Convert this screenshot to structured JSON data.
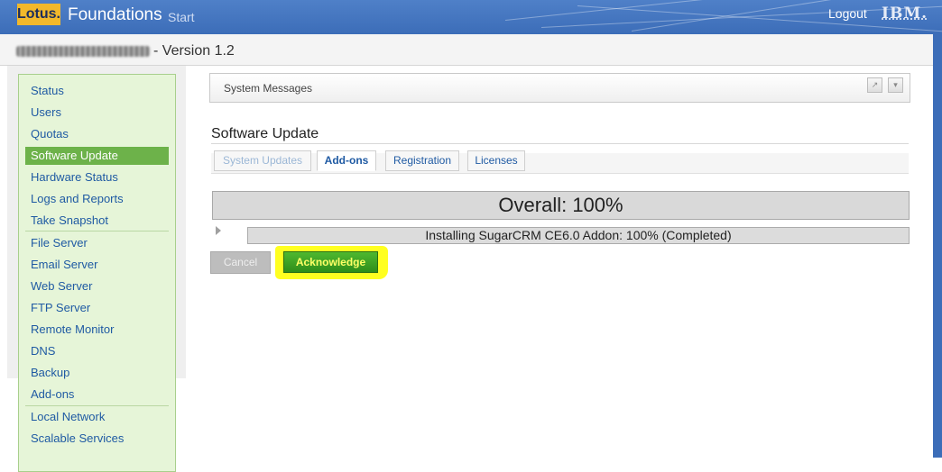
{
  "header": {
    "brand_logo": "Lotus.",
    "product": "Foundations",
    "product_sub": "Start",
    "logout": "Logout",
    "vendor_logo": "IBM."
  },
  "host": {
    "version": "- Version 1.2"
  },
  "nav": {
    "items": [
      {
        "label": "Status",
        "active": false
      },
      {
        "label": "Users",
        "active": false
      },
      {
        "label": "Quotas",
        "active": false
      },
      {
        "label": "Software Update",
        "active": true
      },
      {
        "label": "Hardware Status",
        "active": false
      },
      {
        "label": "Logs and Reports",
        "active": false
      },
      {
        "label": "Take Snapshot",
        "active": false
      },
      {
        "label": "File Server",
        "active": false
      },
      {
        "label": "Email Server",
        "active": false
      },
      {
        "label": "Web Server",
        "active": false
      },
      {
        "label": "FTP Server",
        "active": false
      },
      {
        "label": "Remote Monitor",
        "active": false
      },
      {
        "label": "DNS",
        "active": false
      },
      {
        "label": "Backup",
        "active": false
      },
      {
        "label": "Add-ons",
        "active": false
      },
      {
        "label": "Local Network",
        "active": false
      },
      {
        "label": "Scalable Services",
        "active": false
      }
    ]
  },
  "system_messages": {
    "label": "System Messages",
    "popout_icon": "popout-icon",
    "menu_icon": "chevron-down-icon"
  },
  "main": {
    "title": "Software Update",
    "tabs": [
      {
        "label": "System Updates",
        "state": "disabled"
      },
      {
        "label": "Add-ons",
        "state": "active"
      },
      {
        "label": "Registration",
        "state": "normal"
      },
      {
        "label": "Licenses",
        "state": "normal"
      }
    ],
    "overall": "Overall: 100%",
    "overall_progress": 100,
    "detail": "Installing SugarCRM CE6.0 Addon: 100% (Completed)",
    "detail_progress": 100,
    "cancel": "Cancel",
    "acknowledge": "Acknowledge"
  },
  "colors": {
    "banner": "#3c6db8",
    "nav_bg": "#e6f5d8",
    "nav_active": "#6db24a",
    "highlight": "#ffff20",
    "ack_button": "#3a9e22"
  }
}
